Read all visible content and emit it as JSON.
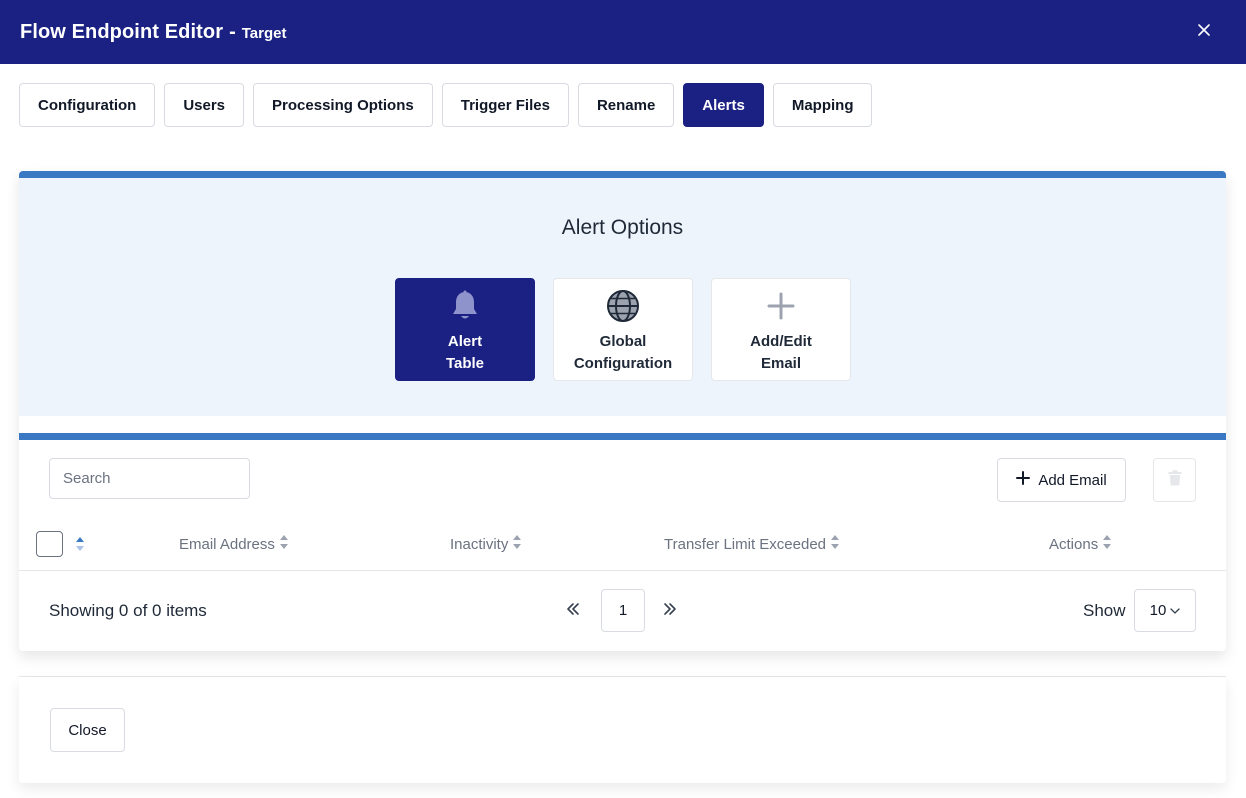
{
  "header": {
    "title": "Flow Endpoint Editor",
    "separator": "-",
    "subtitle": "Target",
    "close_icon": "close-icon"
  },
  "tabs": [
    {
      "label": "Configuration",
      "active": false
    },
    {
      "label": "Users",
      "active": false
    },
    {
      "label": "Processing Options",
      "active": false
    },
    {
      "label": "Trigger Files",
      "active": false
    },
    {
      "label": "Rename",
      "active": false
    },
    {
      "label": "Alerts",
      "active": true
    },
    {
      "label": "Mapping",
      "active": false
    }
  ],
  "alert_options": {
    "title": "Alert Options",
    "buttons": [
      {
        "line1": "Alert",
        "line2": "Table",
        "icon": "bell-icon",
        "active": true
      },
      {
        "line1": "Global",
        "line2": "Configuration",
        "icon": "globe-icon",
        "active": false
      },
      {
        "line1": "Add/Edit",
        "line2": "Email",
        "icon": "plus-icon",
        "active": false
      }
    ]
  },
  "table": {
    "search_placeholder": "Search",
    "add_email_label": "Add Email",
    "columns": [
      "Email Address",
      "Inactivity",
      "Transfer Limit Exceeded",
      "Actions"
    ],
    "rows": []
  },
  "pagination": {
    "showing": "Showing 0 of 0 items",
    "current_page": "1",
    "show_label": "Show",
    "page_size": "10"
  },
  "footer": {
    "close_label": "Close"
  },
  "colors": {
    "primary": "#1a2183",
    "accent_bar": "#3b78c4",
    "panel_bg": "#edf4fc",
    "sort_active": "#3b78c4"
  }
}
